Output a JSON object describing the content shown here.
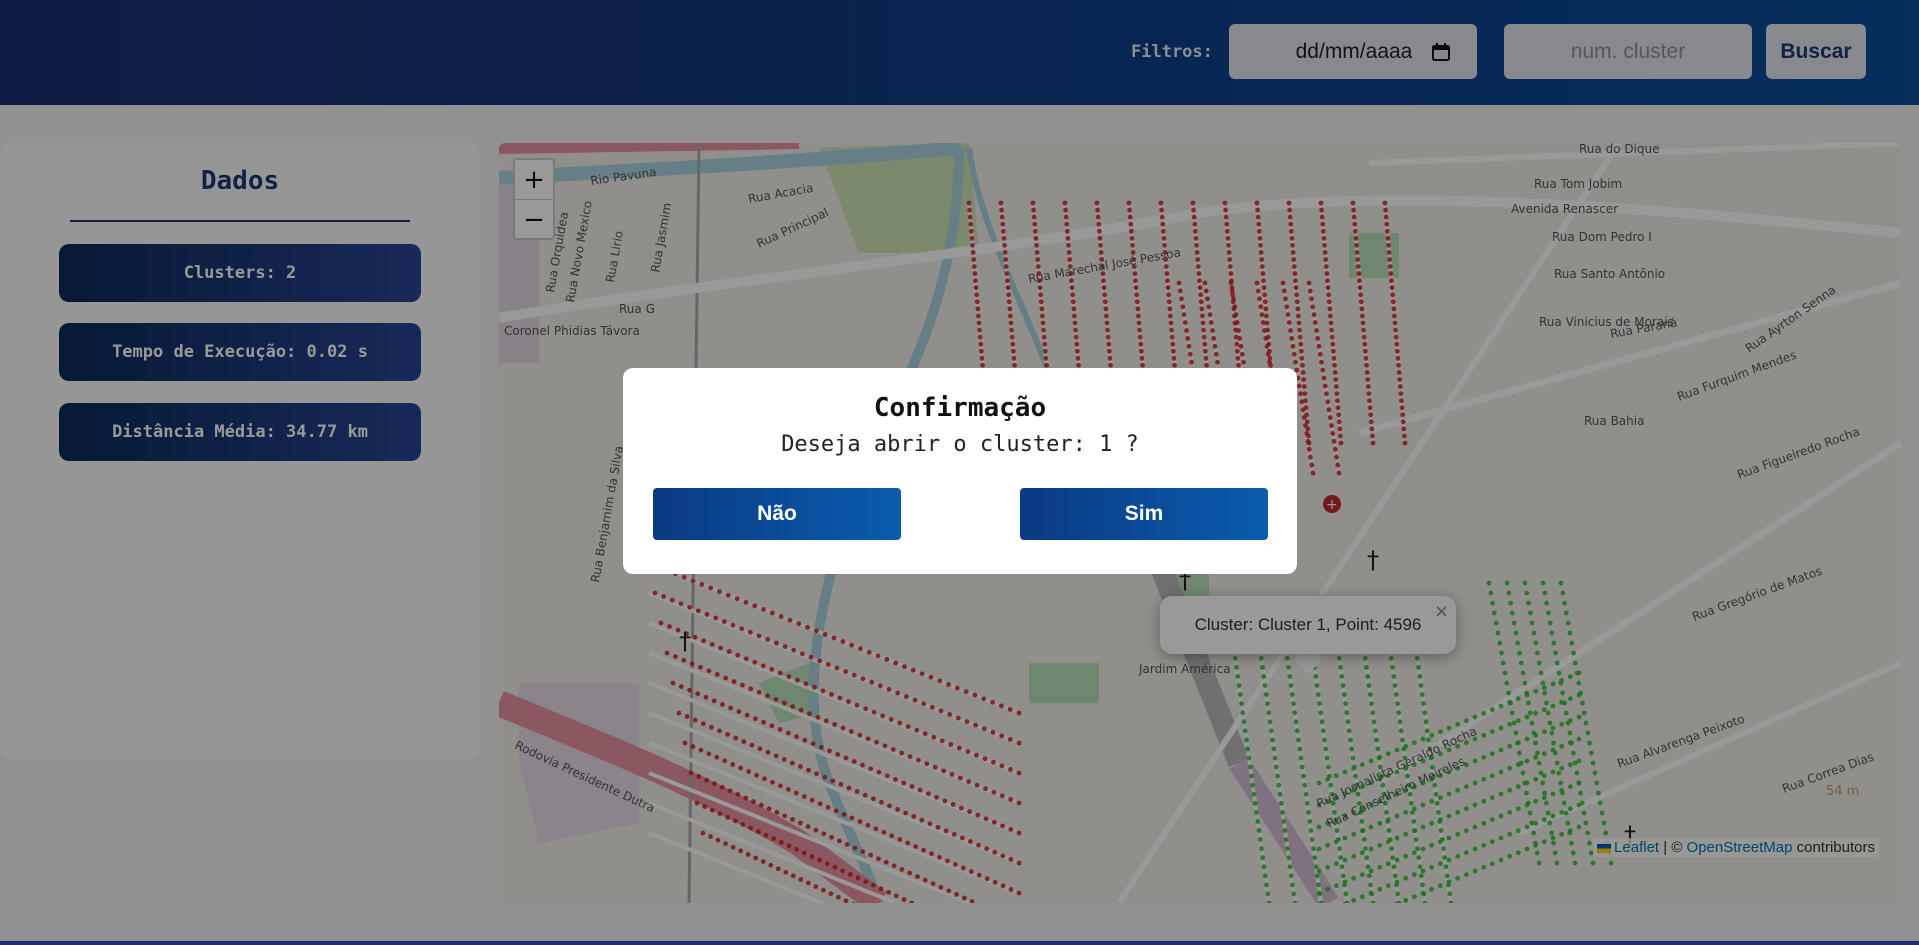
{
  "header": {
    "filters_label": "Filtros:",
    "date_placeholder": "dd/mm/aaaa",
    "cluster_placeholder": "num. cluster",
    "search_label": "Buscar",
    "bg_color": "#1d2f72"
  },
  "panel": {
    "title": "Dados",
    "stats": [
      {
        "label": "Clusters: 2"
      },
      {
        "label": "Tempo de Execução: 0.02 s"
      },
      {
        "label": "Distância Média: 34.77 km"
      }
    ]
  },
  "map": {
    "zoom_in": "+",
    "zoom_out": "−",
    "popup_text": "Cluster: Cluster 1, Point: 4596",
    "popup_close": "×",
    "scale_label": "54 m",
    "attribution": {
      "leaflet": "Leaflet",
      "sep": " | © ",
      "osm": "OpenStreetMap",
      "suffix": " contributors"
    },
    "street_labels": [
      "Rio Pavuna",
      "Rua Acacia",
      "Rua Principal",
      "Rua Jasmim",
      "Rua Lirio",
      "Rua Novo Mexico",
      "Rua Orquidea",
      "Rua G",
      "Coronel Phidias Távora",
      "Rua Benjamim da Silva",
      "Rodovia Presidente Dutra",
      "Rua do Dique",
      "Rua Tom Jobim",
      "Avenida Renascer",
      "Rua Dom Pedro I",
      "Rua Santo Antônio",
      "Rua Vinicius de Morais",
      "Rua Paraná",
      "Rua Bahia",
      "Rua Furquim Mendes",
      "Rua Figueiredo Rocha",
      "Rua Gregório de Matos",
      "Rua Alvarenga Peixoto",
      "Rua Correa Dias",
      "Jardim América",
      "Rua Josnalista Geraldo Rocha",
      "Rua Conselheiro Meireles",
      "Rua Marechal José Pessoa",
      "Rua Ayrton Senna",
      "Rio Pavuna",
      "Rua Caiçarapá"
    ],
    "cluster_colors": [
      "#d42020",
      "#2ec02e"
    ]
  },
  "modal": {
    "title": "Confirmação",
    "message": "Deseja abrir o cluster: 1 ?",
    "no_label": "Não",
    "yes_label": "Sim"
  }
}
